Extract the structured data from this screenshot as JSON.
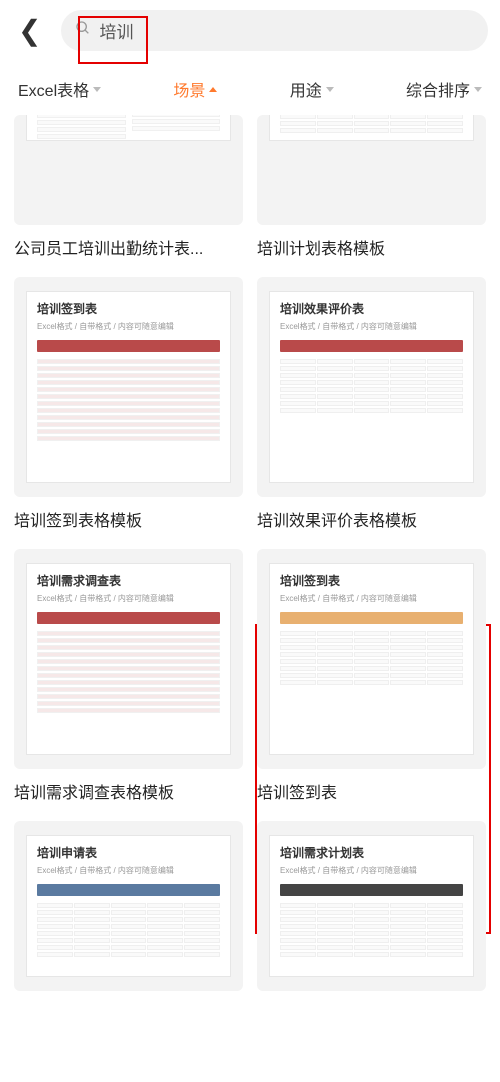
{
  "search": {
    "placeholder": "培训"
  },
  "filters": [
    {
      "label": "Excel表格",
      "active": false
    },
    {
      "label": "场景",
      "active": true
    },
    {
      "label": "用途",
      "active": false
    },
    {
      "label": "综合排序",
      "active": false
    }
  ],
  "doc_subtitle": "Excel格式 / 自带格式 / 内容可随意编辑",
  "cards": [
    {
      "title": "公司员工培训出勤统计表...",
      "doc_title": "",
      "color": "",
      "partial": "top",
      "variant": "stats"
    },
    {
      "title": "培训计划表格模板",
      "doc_title": "",
      "color": "",
      "partial": "top",
      "variant": "pinktable"
    },
    {
      "title": "培训签到表格模板",
      "doc_title": "培训签到表",
      "color": "#b94a4a",
      "variant": "rows"
    },
    {
      "title": "培训效果评价表格模板",
      "doc_title": "培训效果评价表",
      "color": "#b94a4a",
      "variant": "grid"
    },
    {
      "title": "培训需求调查表格模板",
      "doc_title": "培训需求调查表",
      "color": "#b94a4a",
      "variant": "rows"
    },
    {
      "title": "培训签到表",
      "doc_title": "培训签到表",
      "color": "#e8b070",
      "variant": "grid"
    },
    {
      "title": "",
      "doc_title": "培训申请表",
      "color": "#5a7aa0",
      "partial": "bottom",
      "variant": "grid"
    },
    {
      "title": "",
      "doc_title": "培训需求计划表",
      "color": "#444",
      "partial": "bottom",
      "variant": "grid"
    }
  ]
}
